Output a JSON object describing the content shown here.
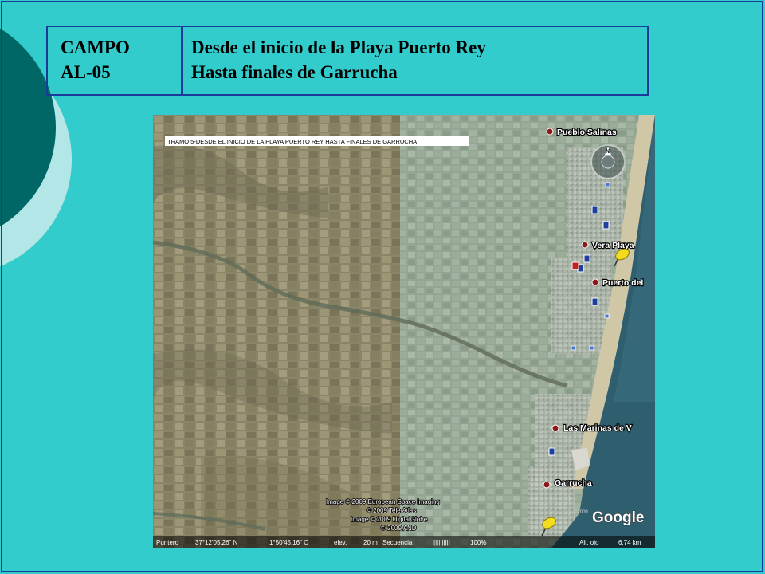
{
  "slide": {
    "left_cell": {
      "line1": "CAMPO",
      "line2": "AL-05"
    },
    "right_cell": {
      "line1": "Desde el inicio de la Playa Puerto Rey",
      "line2": "Hasta finales de Garrucha"
    }
  },
  "map": {
    "banner": "TRAMO 5-DESDE EL INICIO DE LA PLAYA PUERTO REY HASTA FINALES DE GARRUCHA",
    "places": [
      {
        "name": "Pueblo Salinas"
      },
      {
        "name": "Vera Playa"
      },
      {
        "name": "Puerto del"
      },
      {
        "name": "Las Marinas de V"
      },
      {
        "name": "Garrucha"
      }
    ],
    "credits": [
      "Image © 2009 European Space Imaging",
      "© 2009 Tele Atlas",
      "Image © 2009 DigitalGlobe",
      "© 2009 AND"
    ],
    "google_logo": "Google",
    "google_copyright": "©2009",
    "compass_letter": "N",
    "status": {
      "pointer_label": "Puntero",
      "lat": "37°12'05.26\" N",
      "lon": "1°50'45.16\" O",
      "elev_label": "elev.",
      "elev_value": "20 m",
      "sequence_label": "Secuencia",
      "sequence_bars": "||||||||||",
      "percent": "100%",
      "eye_alt_label": "Alt. ojo",
      "eye_alt_value": "6.74 km"
    }
  }
}
